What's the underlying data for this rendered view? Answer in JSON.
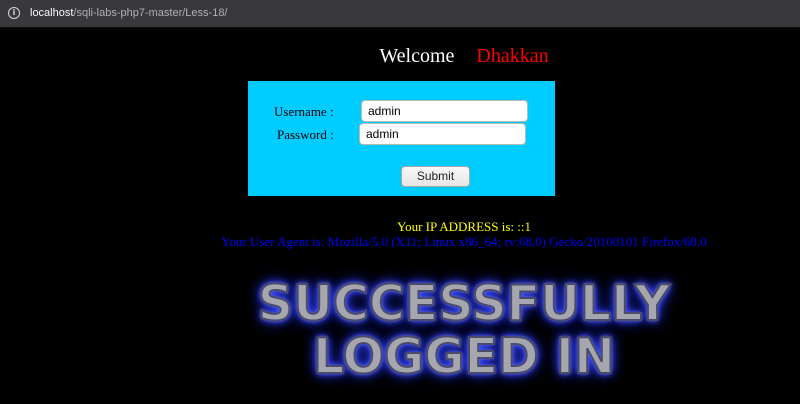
{
  "address_bar": {
    "host": "localhost",
    "path": "/sqli-labs-php7-master/Less-18/"
  },
  "header": {
    "welcome": "Welcome",
    "name": "Dhakkan"
  },
  "login_form": {
    "username_label": "Username :",
    "username_value": "admin",
    "password_label": "Password :",
    "password_value": "admin",
    "submit_label": "Submit"
  },
  "info": {
    "ip_line": "Your IP ADDRESS is: ::1",
    "user_agent_line": "Your User Agent is: Mozilla/5.0 (X11; Linux x86_64; rv:68.0) Gecko/20100101 Firefox/68.0"
  },
  "banner": {
    "line1": "SUCCESSFULLY",
    "line2": "LOGGED IN"
  },
  "colors": {
    "page_bg": "#000000",
    "form_bg": "#00ccff",
    "name": "#ff0000",
    "ip_text": "#ffff00",
    "user_agent_text": "#0000ff"
  },
  "icons": {
    "site_info": "info-icon"
  }
}
